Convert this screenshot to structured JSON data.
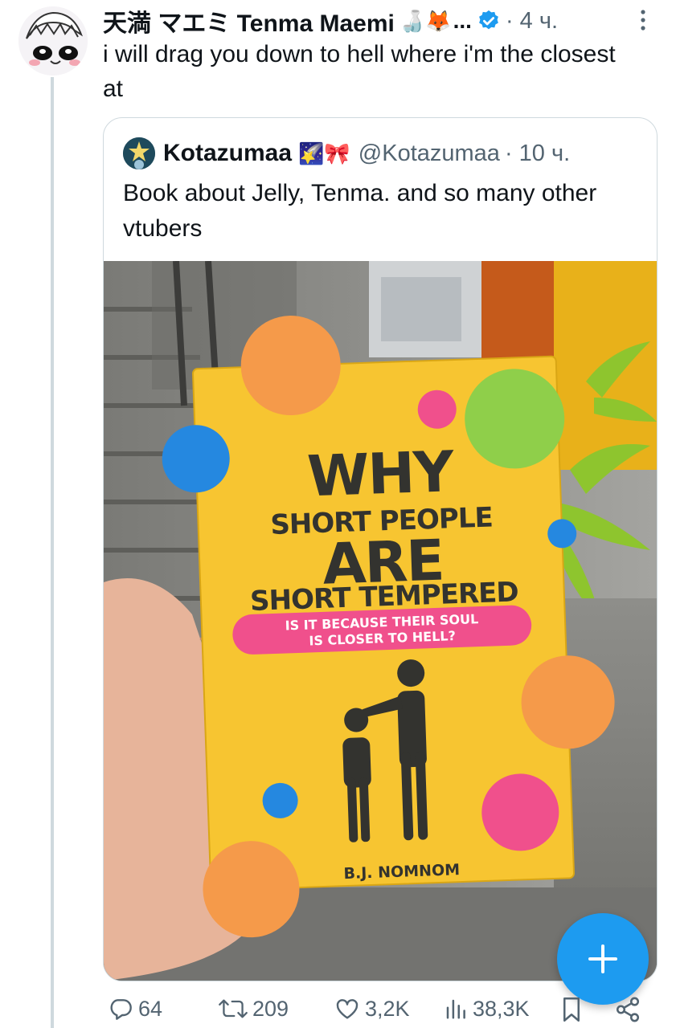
{
  "post": {
    "display_name": "天満 マエミ Tenma Maemi",
    "name_emojis": "🍶🦊",
    "ellipsis": "...",
    "time": "· 4 ч.",
    "text": "i will drag you down to hell where i'm the closest at"
  },
  "quote": {
    "display_name": "Kotazumaa",
    "name_emojis": "🌠🎀",
    "handle": "@Kotazumaa",
    "time": "· 10 ч.",
    "text": "Book about Jelly, Tenma. and so many other vtubers"
  },
  "photo": {
    "book": {
      "line1": "WHY",
      "line2": "SHORT PEOPLE",
      "line3": "ARE",
      "line4": "SHORT TEMPERED",
      "subtitle_line1": "IS IT BECAUSE THEIR SOUL",
      "subtitle_line2": "IS CLOSER TO HELL?",
      "author": "B.J. NOMNOM"
    }
  },
  "actions": {
    "replies": "64",
    "reposts": "209",
    "likes": "3,2K",
    "views": "38,3K"
  },
  "icons": {
    "verified": "verified-badge-icon",
    "more": "more-vertical-icon",
    "reply": "reply-icon",
    "repost": "repost-icon",
    "like": "heart-icon",
    "views": "views-icon",
    "bookmark": "bookmark-icon",
    "share": "share-icon",
    "compose": "plus-icon"
  },
  "colors": {
    "accent": "#1d9bf0",
    "muted_text": "#536471",
    "book_cover": "#f7c531",
    "subtitle_pill": "#f0508c"
  }
}
